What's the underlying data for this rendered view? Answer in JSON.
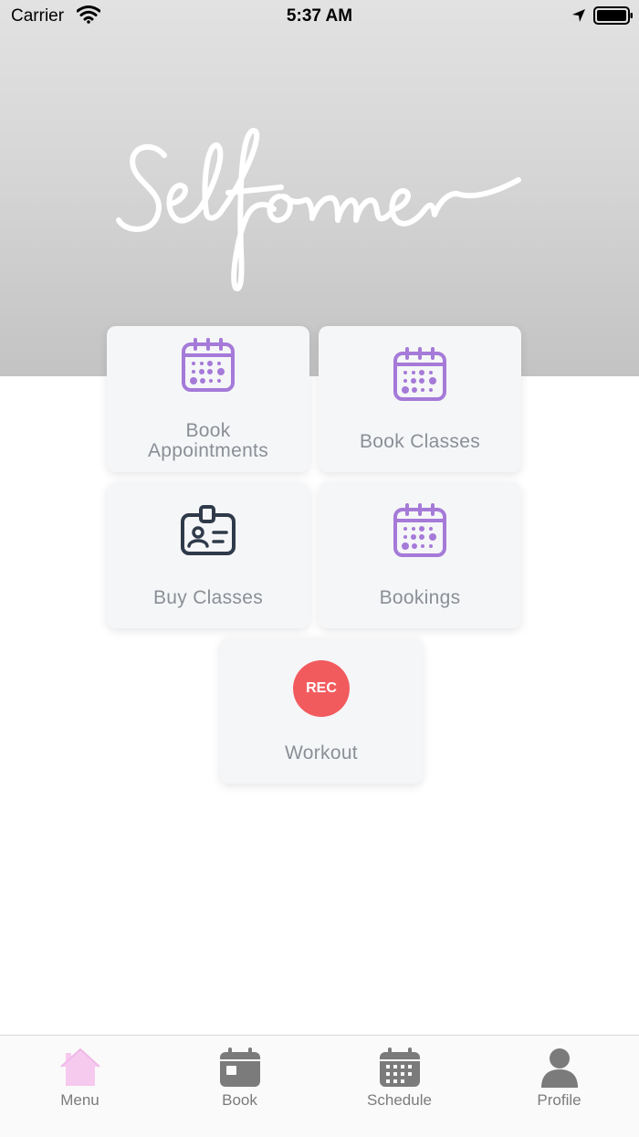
{
  "status_bar": {
    "carrier": "Carrier",
    "time": "5:37 AM"
  },
  "header": {
    "logo_text": "Selformer"
  },
  "tiles": [
    {
      "label_line1": "Book",
      "label_line2": "Appointments",
      "icon": "calendar-dots-icon"
    },
    {
      "label": "Book Classes",
      "icon": "calendar-dots-icon"
    },
    {
      "label": "Buy Classes",
      "icon": "id-card-icon"
    },
    {
      "label": "Bookings",
      "icon": "calendar-dots-icon"
    },
    {
      "label": "Workout",
      "badge": "REC",
      "icon": "rec-badge"
    }
  ],
  "tabbar": {
    "items": [
      {
        "label": "Menu",
        "icon": "home-icon",
        "active": true
      },
      {
        "label": "Book",
        "icon": "calendar-icon"
      },
      {
        "label": "Schedule",
        "icon": "calendar-grid-icon"
      },
      {
        "label": "Profile",
        "icon": "person-icon"
      }
    ]
  },
  "colors": {
    "accent_purple": "#a57ad8",
    "dark_icon": "#2f3a4a",
    "rec_red": "#f25b5e",
    "active_tab": "#f6c9ef",
    "inactive_tab": "#7b7b7b"
  }
}
